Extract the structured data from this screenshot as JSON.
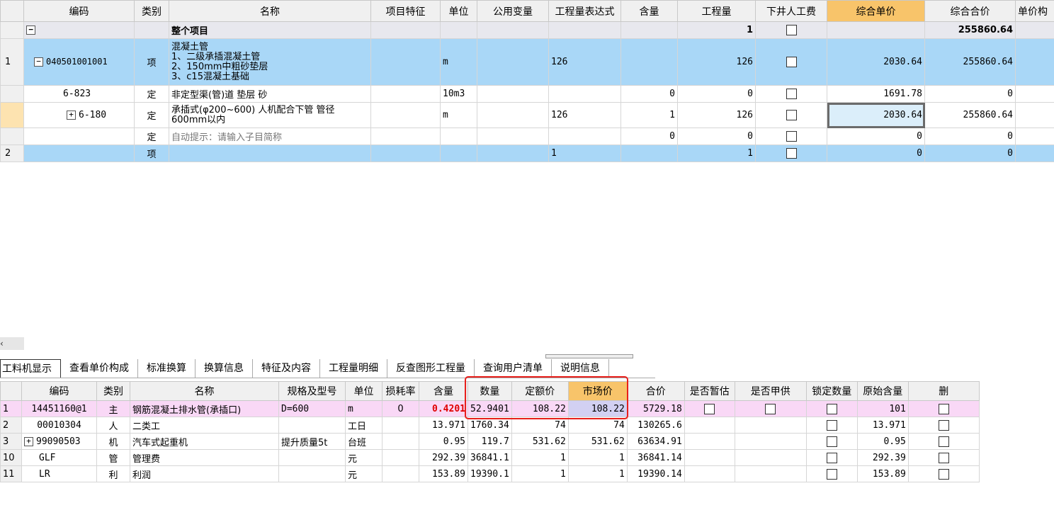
{
  "top": {
    "headers": [
      "编码",
      "类别",
      "名称",
      "项目特征",
      "单位",
      "公用变量",
      "工程量表达式",
      "含量",
      "工程量",
      "下井人工费",
      "综合单价",
      "综合合价",
      "单价构"
    ],
    "rows": [
      {
        "rn": "",
        "code": "",
        "type": "",
        "name": "整个项目",
        "unit": "",
        "expr": "",
        "content": "",
        "qty": "1",
        "unit_price": "",
        "total": "255860.64"
      },
      {
        "rn": "1",
        "code": "040501001001",
        "type": "项",
        "name": "混凝土管\n1、二级承插混凝土管\n2、150mm中粗砂垫层\n3、c15混凝土基础",
        "unit": "m",
        "expr": "126",
        "content": "",
        "qty": "126",
        "unit_price": "2030.64",
        "total": "255860.64"
      },
      {
        "rn": "",
        "code": "6-823",
        "type": "定",
        "name": "非定型渠(管)道 垫层 砂",
        "unit": "10m3",
        "expr": "",
        "content": "0",
        "qty": "0",
        "unit_price": "1691.78",
        "total": "0"
      },
      {
        "rn": "",
        "code": "6-180",
        "type": "定",
        "name": "承插式(φ200~600) 人机配合下管 管径600mm以内",
        "unit": "m",
        "expr": "126",
        "content": "1",
        "qty": "126",
        "unit_price": "2030.64",
        "total": "255860.64"
      },
      {
        "rn": "",
        "code": "",
        "type": "定",
        "name": "自动提示：请输入子目简称",
        "unit": "",
        "expr": "",
        "content": "0",
        "qty": "0",
        "unit_price": "0",
        "total": "0"
      },
      {
        "rn": "2",
        "code": "",
        "type": "项",
        "name": "",
        "unit": "",
        "expr": "1",
        "content": "",
        "qty": "1",
        "unit_price": "0",
        "total": "0"
      }
    ]
  },
  "tabs": [
    "工料机显示",
    "查看单价构成",
    "标准换算",
    "换算信息",
    "特征及内容",
    "工程量明细",
    "反查图形工程量",
    "查询用户清单",
    "说明信息"
  ],
  "bottom": {
    "headers": [
      "",
      "编码",
      "类别",
      "名称",
      "规格及型号",
      "单位",
      "损耗率",
      "含量",
      "数量",
      "定额价",
      "市场价",
      "合价",
      "是否暂估",
      "是否甲供",
      "锁定数量",
      "原始含量",
      "删"
    ],
    "rows": [
      {
        "rn": "1",
        "code": "14451160@1",
        "type": "主",
        "name": "钢筋混凝土排水管(承插口)",
        "spec": "D=600",
        "unit": "m",
        "loss": "0",
        "content": "0.4201",
        "qty": "52.9401",
        "quota": "108.22",
        "market": "108.22",
        "total": "5729.18",
        "orig": "101"
      },
      {
        "rn": "2",
        "code": "00010304",
        "type": "人",
        "name": "二类工",
        "spec": "",
        "unit": "工日",
        "loss": "",
        "content": "13.971",
        "qty": "1760.34",
        "quota": "74",
        "market": "74",
        "total": "130265.6",
        "orig": "13.971"
      },
      {
        "rn": "3",
        "code": "99090503",
        "type": "机",
        "name": "汽车式起重机",
        "spec": "提升质量5t",
        "unit": "台班",
        "loss": "",
        "content": "0.95",
        "qty": "119.7",
        "quota": "531.62",
        "market": "531.62",
        "total": "63634.91",
        "orig": "0.95"
      },
      {
        "rn": "10",
        "code": "GLF",
        "type": "管",
        "name": "管理费",
        "spec": "",
        "unit": "元",
        "loss": "",
        "content": "292.39",
        "qty": "36841.1",
        "quota": "1",
        "market": "1",
        "total": "36841.14",
        "orig": "292.39"
      },
      {
        "rn": "11",
        "code": "LR",
        "type": "利",
        "name": "利润",
        "spec": "",
        "unit": "元",
        "loss": "",
        "content": "153.89",
        "qty": "19390.1",
        "quota": "1",
        "market": "1",
        "total": "19390.14",
        "orig": "153.89"
      }
    ]
  },
  "icons": {
    "collapse": "minus-box-icon",
    "expand": "plus-box-icon",
    "scroll_left": "chevron-left-icon"
  },
  "colors": {
    "selected_row": "#a9d7f7",
    "header_highlight": "#f8c46a",
    "pink_row": "#f9d8f6",
    "red_box": "#e8201c"
  }
}
